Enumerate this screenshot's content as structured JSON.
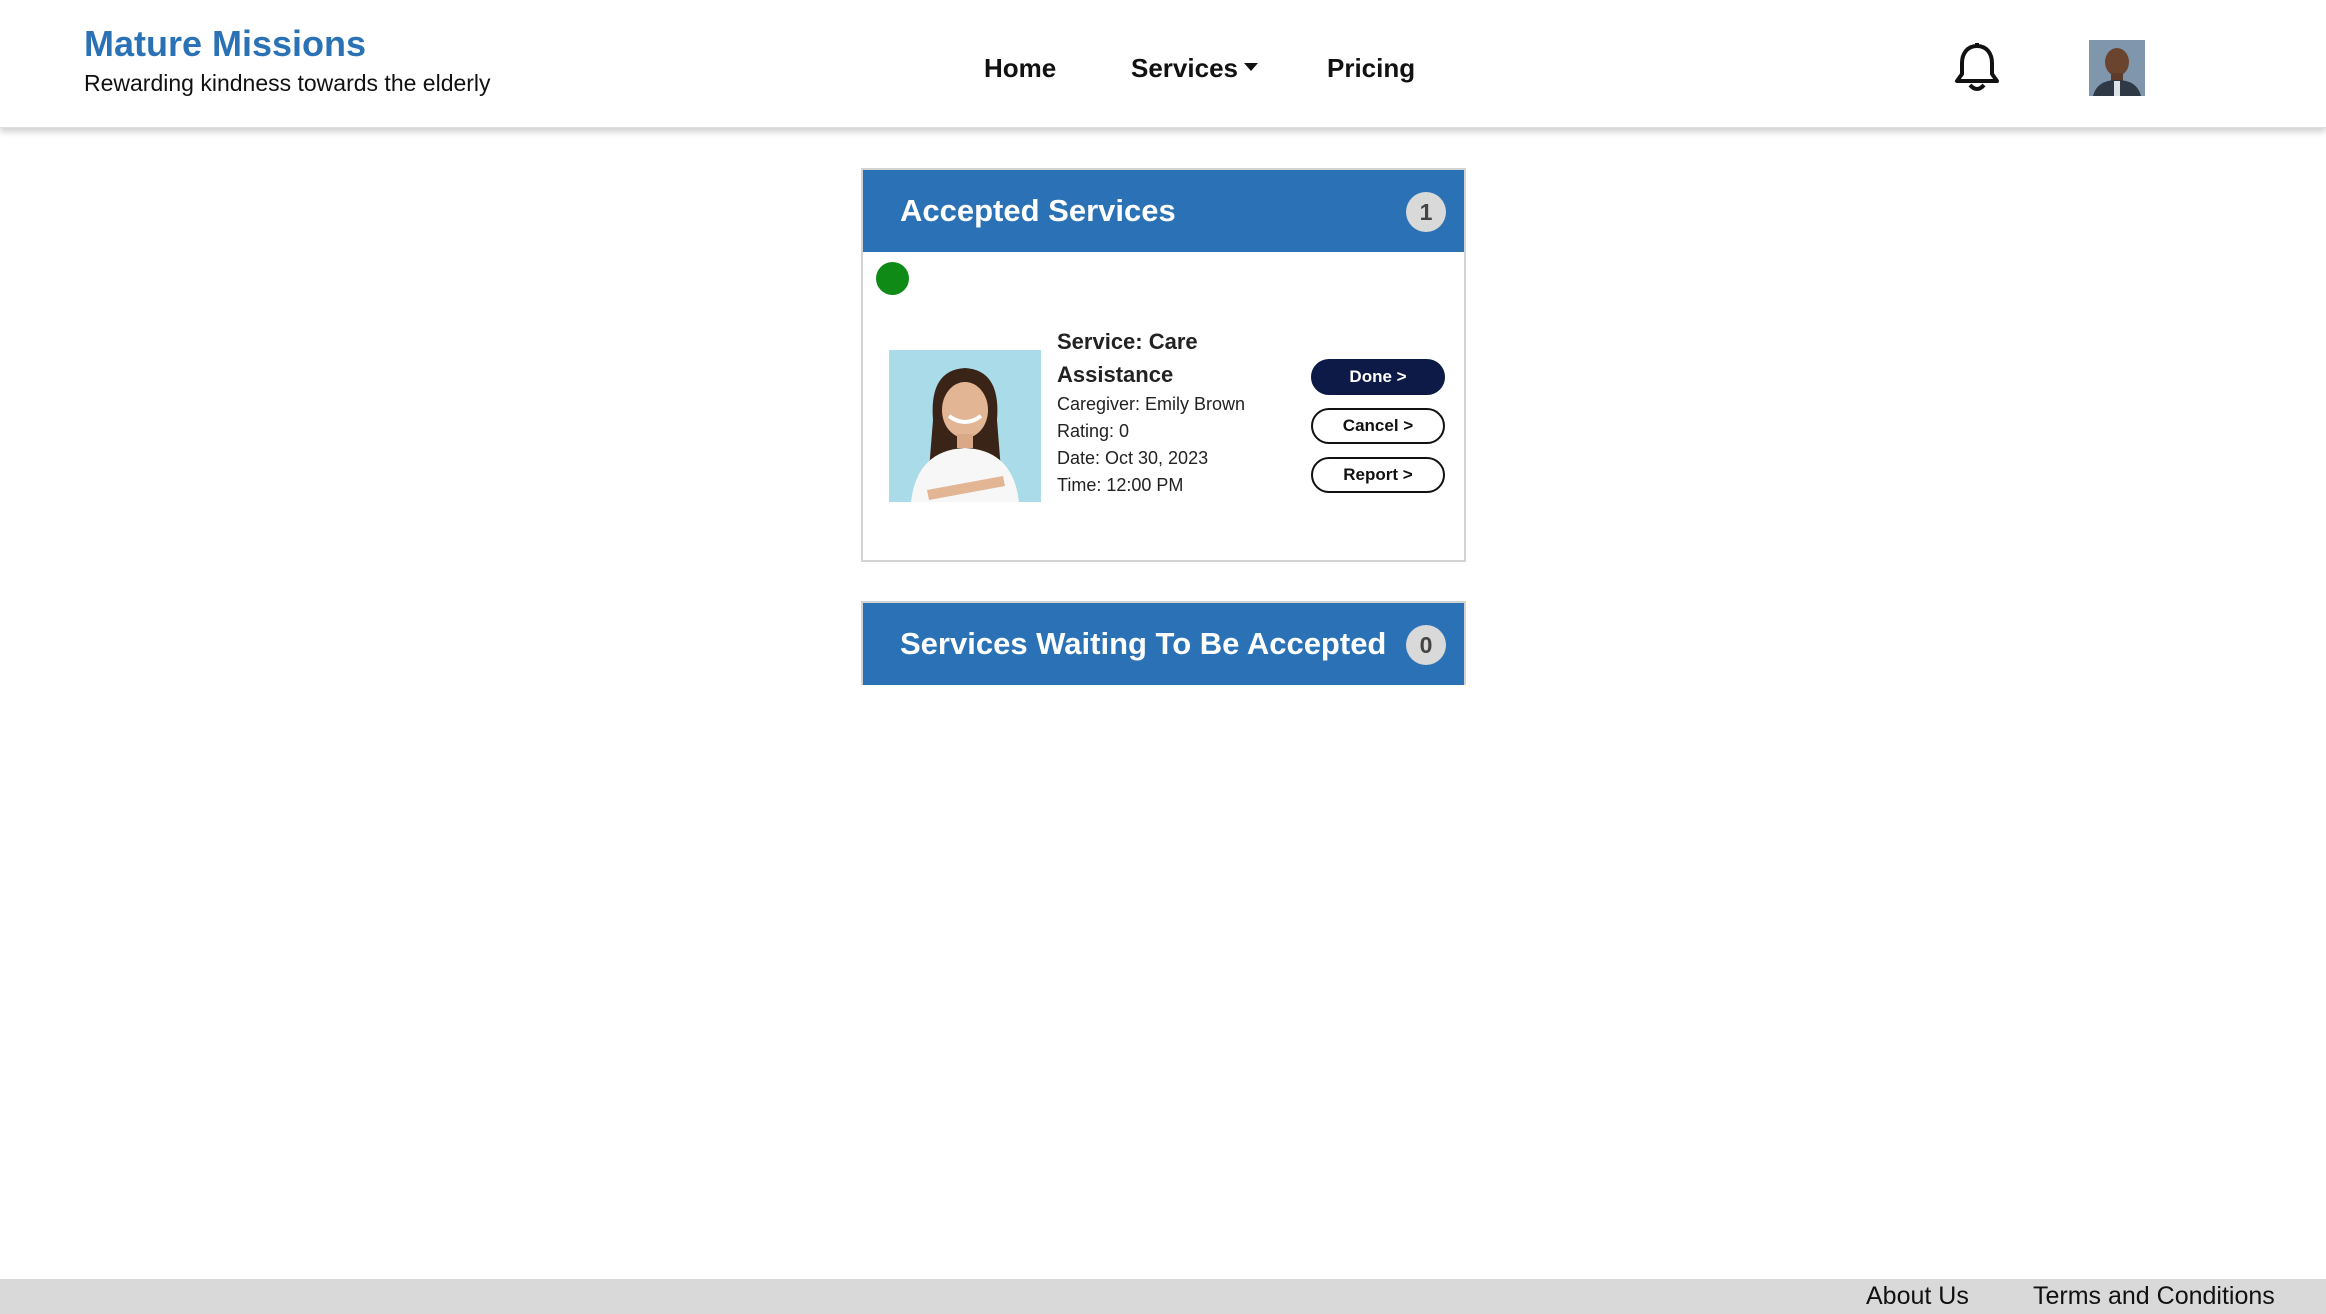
{
  "brand": {
    "title": "Mature Missions",
    "tagline": "Rewarding kindness towards the elderly"
  },
  "nav": {
    "home": "Home",
    "services": "Services",
    "pricing": "Pricing"
  },
  "header_icons": {
    "notifications": "bell-icon",
    "profile": "avatar"
  },
  "accepted": {
    "title": "Accepted Services",
    "count": "1",
    "status_color": "#0f8a16",
    "item": {
      "service": "Service: Care Assistance",
      "caregiver": "Caregiver: Emily Brown",
      "rating": "Rating: 0",
      "date": "Date: Oct 30, 2023",
      "time": "Time: 12:00 PM",
      "actions": {
        "done": "Done >",
        "cancel": "Cancel >",
        "report": "Report >"
      }
    }
  },
  "waiting": {
    "title": "Services Waiting To Be Accepted",
    "count": "0"
  },
  "footer": {
    "about": "About Us",
    "terms": "Terms and Conditions"
  },
  "colors": {
    "brand": "#2a72b5",
    "panel_header": "#2a72b5",
    "done_button": "#0d1a47",
    "footer": "#d9d9d9"
  }
}
